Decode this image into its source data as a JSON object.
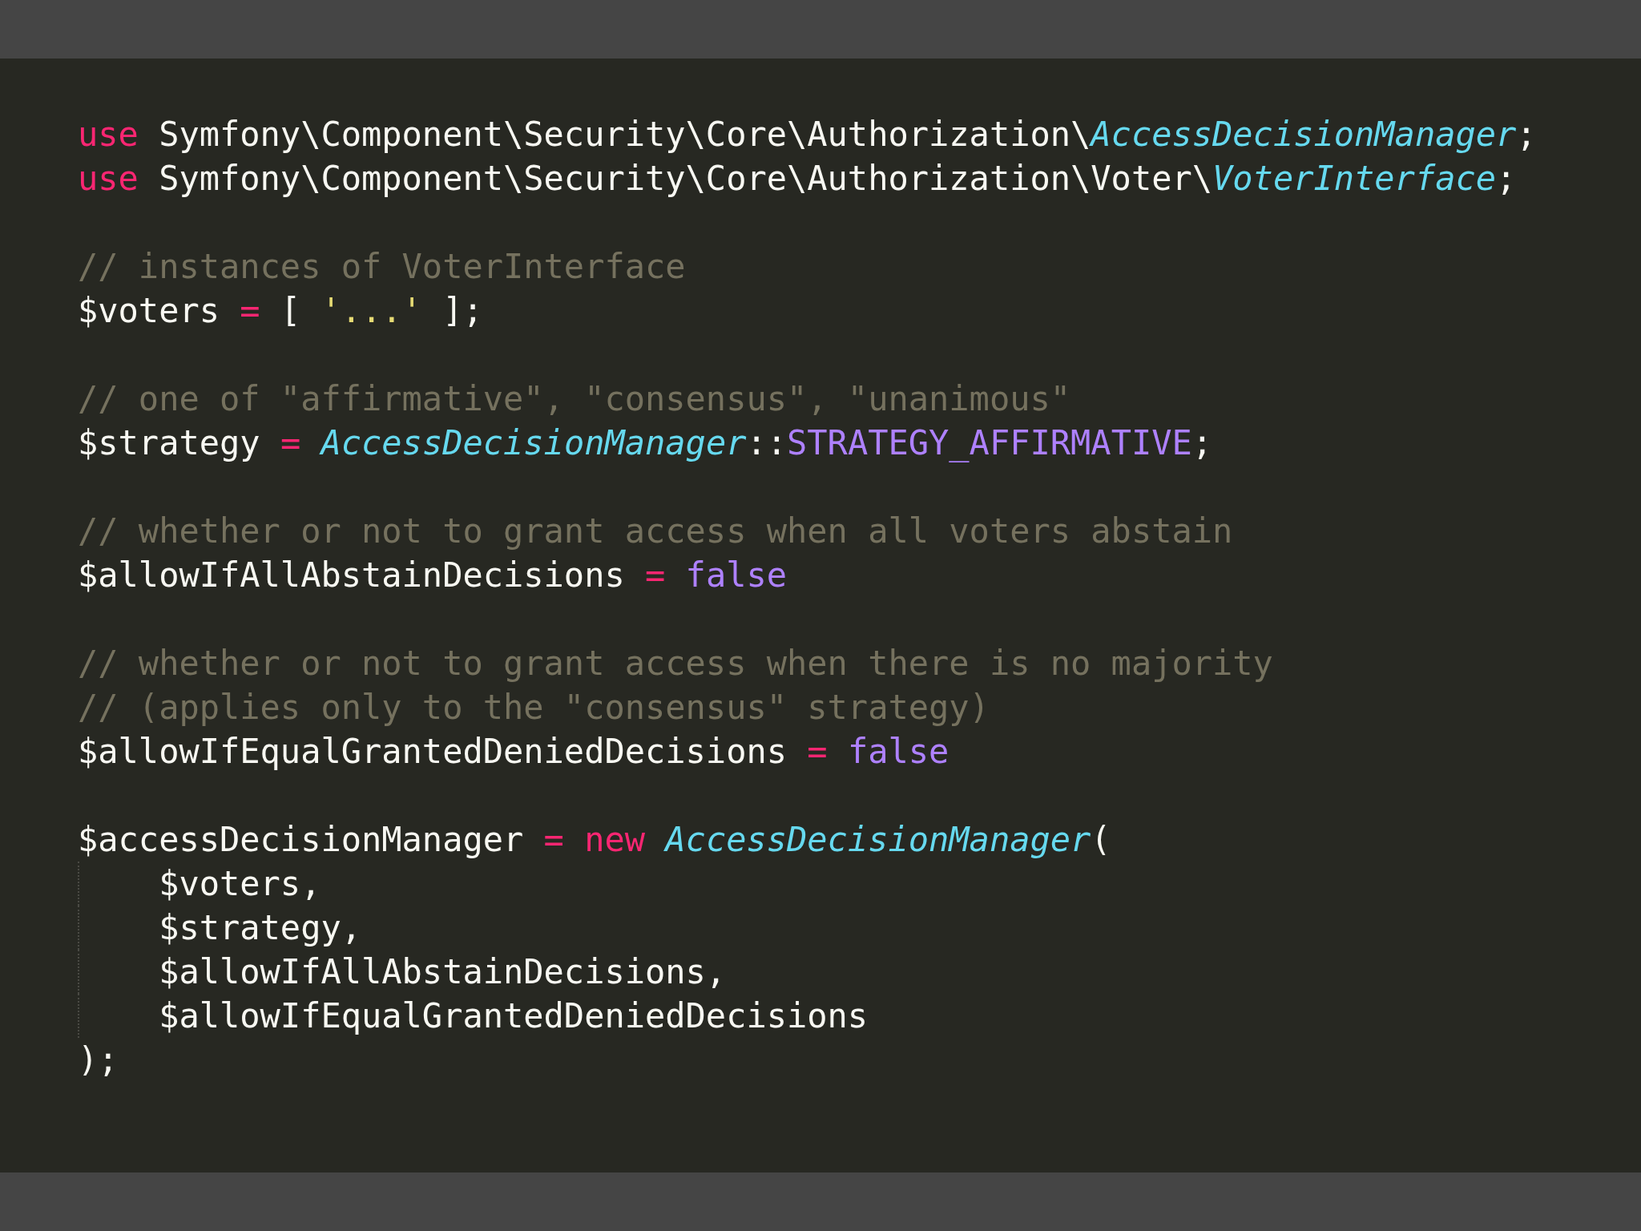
{
  "blocks": [
    {
      "lines": [
        {
          "tokens": [
            {
              "text": "use",
              "kind": "keyword"
            },
            {
              "text": " Symfony\\Component\\Security\\Core\\Authorization\\",
              "kind": "plain"
            },
            {
              "text": "AccessDecisionManager",
              "kind": "class"
            },
            {
              "text": ";",
              "kind": "plain"
            }
          ]
        },
        {
          "tokens": [
            {
              "text": "use",
              "kind": "keyword"
            },
            {
              "text": " Symfony\\Component\\Security\\Core\\Authorization\\Voter\\",
              "kind": "plain"
            },
            {
              "text": "VoterInterface",
              "kind": "class"
            },
            {
              "text": ";",
              "kind": "plain"
            }
          ]
        }
      ]
    },
    {
      "lines": [
        {
          "tokens": [
            {
              "text": "// instances of VoterInterface",
              "kind": "comment"
            }
          ]
        },
        {
          "tokens": [
            {
              "text": "$voters ",
              "kind": "plain"
            },
            {
              "text": "=",
              "kind": "keyword"
            },
            {
              "text": " [ ",
              "kind": "plain"
            },
            {
              "text": "'...'",
              "kind": "string"
            },
            {
              "text": " ];",
              "kind": "plain"
            }
          ]
        }
      ]
    },
    {
      "lines": [
        {
          "tokens": [
            {
              "text": "// one of \"affirmative\", \"consensus\", \"unanimous\"",
              "kind": "comment"
            }
          ]
        },
        {
          "tokens": [
            {
              "text": "$strategy ",
              "kind": "plain"
            },
            {
              "text": "= ",
              "kind": "keyword"
            },
            {
              "text": "AccessDecisionManager",
              "kind": "class"
            },
            {
              "text": "::",
              "kind": "plain"
            },
            {
              "text": "STRATEGY_AFFIRMATIVE",
              "kind": "constant"
            },
            {
              "text": ";",
              "kind": "plain"
            }
          ]
        }
      ]
    },
    {
      "lines": [
        {
          "tokens": [
            {
              "text": "// whether or not to grant access when all voters abstain",
              "kind": "comment"
            }
          ]
        },
        {
          "tokens": [
            {
              "text": "$allowIfAllAbstainDecisions ",
              "kind": "plain"
            },
            {
              "text": "= ",
              "kind": "keyword"
            },
            {
              "text": "false",
              "kind": "constant"
            }
          ]
        }
      ]
    },
    {
      "lines": [
        {
          "tokens": [
            {
              "text": "// whether or not to grant access when there is no majority",
              "kind": "comment"
            }
          ]
        },
        {
          "tokens": [
            {
              "text": "// (applies only to the \"consensus\" strategy)",
              "kind": "comment"
            }
          ]
        },
        {
          "tokens": [
            {
              "text": "$allowIfEqualGrantedDeniedDecisions ",
              "kind": "plain"
            },
            {
              "text": "= ",
              "kind": "keyword"
            },
            {
              "text": "false",
              "kind": "constant"
            }
          ]
        }
      ]
    },
    {
      "lines": [
        {
          "tokens": [
            {
              "text": "$accessDecisionManager ",
              "kind": "plain"
            },
            {
              "text": "= new ",
              "kind": "keyword"
            },
            {
              "text": "AccessDecisionManager",
              "kind": "class"
            },
            {
              "text": "(",
              "kind": "plain"
            }
          ]
        },
        {
          "indented": true,
          "tokens": [
            {
              "text": "$voters,",
              "kind": "plain"
            }
          ]
        },
        {
          "indented": true,
          "tokens": [
            {
              "text": "$strategy,",
              "kind": "plain"
            }
          ]
        },
        {
          "indented": true,
          "tokens": [
            {
              "text": "$allowIfAllAbstainDecisions,",
              "kind": "plain"
            }
          ]
        },
        {
          "indented": true,
          "tokens": [
            {
              "text": "$allowIfEqualGrantedDeniedDecisions",
              "kind": "plain"
            }
          ]
        },
        {
          "tokens": [
            {
              "text": ");",
              "kind": "plain"
            }
          ]
        }
      ]
    }
  ]
}
